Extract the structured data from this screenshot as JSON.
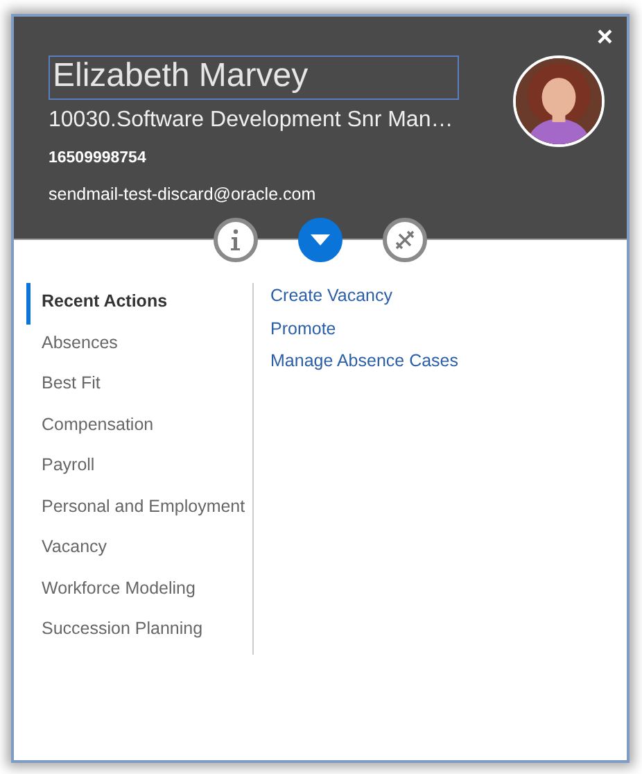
{
  "close": "×",
  "person": {
    "name": "Elizabeth Marvey",
    "title": "10030.Software Development Snr Man…",
    "phone": "16509998754",
    "email": "sendmail-test-discard@oracle.com"
  },
  "tabs": [
    {
      "kind": "info",
      "selected": false
    },
    {
      "kind": "actions",
      "selected": true
    },
    {
      "kind": "tools",
      "selected": false
    }
  ],
  "categories": [
    {
      "label": "Recent Actions",
      "selected": true
    },
    {
      "label": "Absences",
      "selected": false
    },
    {
      "label": "Best Fit",
      "selected": false
    },
    {
      "label": "Compensation",
      "selected": false
    },
    {
      "label": "Payroll",
      "selected": false
    },
    {
      "label": "Personal and Employment",
      "selected": false
    },
    {
      "label": "Vacancy",
      "selected": false
    },
    {
      "label": "Workforce Modeling",
      "selected": false
    },
    {
      "label": "Succession Planning",
      "selected": false
    }
  ],
  "actions": [
    "Create Vacancy",
    "Promote",
    "Manage Absence Cases"
  ]
}
